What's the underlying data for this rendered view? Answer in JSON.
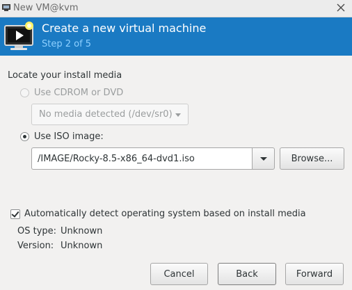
{
  "window": {
    "title": "New VM@kvm"
  },
  "banner": {
    "heading": "Create a new virtual machine",
    "step": "Step 2 of 5"
  },
  "media": {
    "section_label": "Locate your install media",
    "cdrom_label": "Use CDROM or DVD",
    "cdrom_combo_value": "No media detected (/dev/sr0)",
    "iso_label": "Use ISO image:",
    "iso_value": "/IMAGE/Rocky-8.5-x86_64-dvd1.iso",
    "browse_label": "Browse..."
  },
  "detect": {
    "checkbox_label": "Automatically detect operating system based on install media",
    "checked": true,
    "os_type_key": "OS type:",
    "os_type_value": "Unknown",
    "version_key": "Version:",
    "version_value": "Unknown"
  },
  "footer": {
    "cancel_label": "Cancel",
    "back_label": "Back",
    "forward_label": "Forward"
  },
  "colors": {
    "banner": "#1a7ac3",
    "step_text": "#8ed0ff",
    "background": "#f2f1f0"
  },
  "icons": [
    "app-icon",
    "close-icon",
    "virtual-machine-icon",
    "chevron-down-icon"
  ]
}
